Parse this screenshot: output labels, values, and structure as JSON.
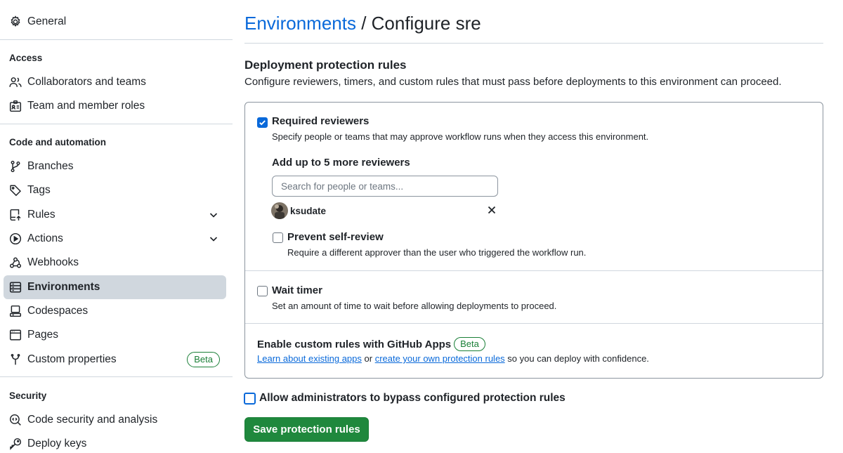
{
  "sidebar": {
    "general": "General",
    "access_title": "Access",
    "collaborators": "Collaborators and teams",
    "team_roles": "Team and member roles",
    "code_title": "Code and automation",
    "branches": "Branches",
    "tags": "Tags",
    "rules": "Rules",
    "actions": "Actions",
    "webhooks": "Webhooks",
    "environments": "Environments",
    "codespaces": "Codespaces",
    "pages": "Pages",
    "custom_properties": "Custom properties",
    "beta": "Beta",
    "security_title": "Security",
    "code_security": "Code security and analysis",
    "deploy_keys": "Deploy keys"
  },
  "header": {
    "breadcrumb_link": "Environments",
    "separator": " / ",
    "title": "Configure sre"
  },
  "protection": {
    "heading": "Deployment protection rules",
    "description": "Configure reviewers, timers, and custom rules that must pass before deployments to this environment can proceed.",
    "required_reviewers": {
      "label": "Required reviewers",
      "checked": true,
      "description": "Specify people or teams that may approve workflow runs when they access this environment.",
      "add_label": "Add up to 5 more reviewers",
      "search_placeholder": "Search for people or teams...",
      "reviewer": "ksudate"
    },
    "prevent_self_review": {
      "label": "Prevent self-review",
      "checked": false,
      "description": "Require a different approver than the user who triggered the workflow run."
    },
    "wait_timer": {
      "label": "Wait timer",
      "checked": false,
      "description": "Set an amount of time to wait before allowing deployments to proceed."
    },
    "custom_rules": {
      "title": "Enable custom rules with GitHub Apps",
      "badge": "Beta",
      "link1": "Learn about existing apps",
      "or": " or ",
      "link2": "create your own protection rules",
      "suffix": " so you can deploy with confidence."
    },
    "bypass": {
      "label": "Allow administrators to bypass configured protection rules",
      "checked": false
    },
    "save_label": "Save protection rules"
  },
  "colors": {
    "link": "#0969da",
    "primary_button": "#1f883d",
    "active_nav": "#d0d7de",
    "beta": "#1a7f37"
  }
}
